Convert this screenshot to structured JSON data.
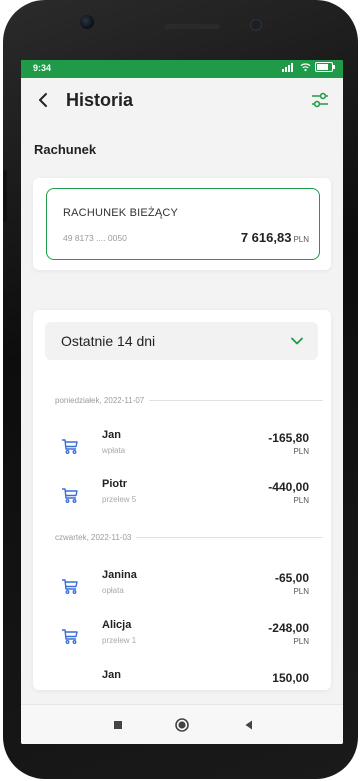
{
  "status_bar": {
    "time": "9:34"
  },
  "header": {
    "title": "Historia"
  },
  "section_label": "Rachunek",
  "account": {
    "name": "RACHUNEK BIEŻĄCY",
    "number": "49 8173 .... 0050",
    "balance_main": "7 616,",
    "balance_decimal": "83",
    "currency": "PLN"
  },
  "period": {
    "label": "Ostatnie 14 dni"
  },
  "groups": [
    {
      "date": "poniedziałek, 2022-11-07",
      "items": [
        {
          "name": "Jan",
          "desc": "wpłata",
          "amount": "-165,80",
          "currency": "PLN"
        },
        {
          "name": "Piotr",
          "desc": "przelew 5",
          "amount": "-440,00",
          "currency": "PLN"
        }
      ]
    },
    {
      "date": "czwartek, 2022-11-03",
      "items": [
        {
          "name": "Janina",
          "desc": "opłata",
          "amount": "-65,00",
          "currency": "PLN"
        },
        {
          "name": "Alicja",
          "desc": "przelew 1",
          "amount": "-248,00",
          "currency": "PLN"
        },
        {
          "name": "Jan",
          "desc": "",
          "amount": "150,00",
          "currency": ""
        }
      ]
    }
  ],
  "colors": {
    "accent": "#1e9a48",
    "cart_icon": "#3a6fd8"
  },
  "icons": {
    "back": "chevron-left-icon",
    "filter": "sliders-icon",
    "period": "chevron-down-icon",
    "transaction": "cart-icon",
    "nav": [
      "square-icon",
      "circle-icon",
      "triangle-left-icon"
    ]
  }
}
